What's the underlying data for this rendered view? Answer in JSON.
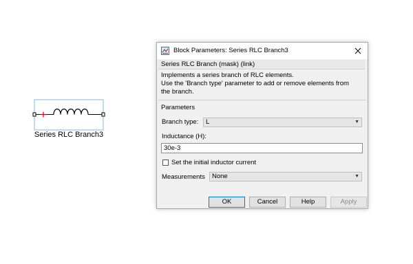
{
  "block": {
    "label": "Series RLC Branch3"
  },
  "dialog": {
    "title": "Block Parameters: Series RLC Branch3",
    "mask_header": "Series RLC Branch (mask) (link)",
    "description_lines": [
      "Implements a series branch of RLC elements.",
      "Use the 'Branch type' parameter to add or remove elements from",
      "the branch."
    ],
    "params_label": "Parameters",
    "branch_type_label": "Branch type:",
    "branch_type_value": "L",
    "inductance_label": "Inductance (H):",
    "inductance_value": "30e-3",
    "initial_current_label": "Set the initial inductor current",
    "measurements_label": "Measurements",
    "measurements_value": "None",
    "buttons": {
      "ok": "OK",
      "cancel": "Cancel",
      "help": "Help",
      "apply": "Apply"
    }
  },
  "colors": {
    "accent": "#0078d7",
    "block_border": "#7fb2e6",
    "port_red": "#d40000"
  }
}
